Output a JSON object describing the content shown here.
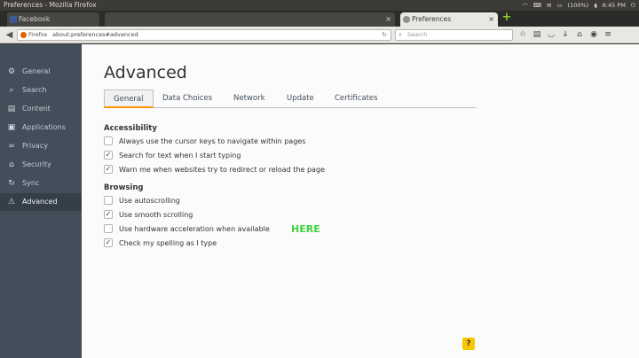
{
  "window": {
    "title": "Preferences - Mozilla Firefox"
  },
  "tray": {
    "battery": "(100%)",
    "time": "6:45 PM"
  },
  "tabs": [
    {
      "label": "Facebook",
      "close": "×"
    },
    {
      "label": "Preferences",
      "close": "×"
    }
  ],
  "newtab_symbol": "+",
  "navbar": {
    "identity": "Firefox",
    "url": "about:preferences#advanced",
    "search_placeholder": "Search"
  },
  "sidebar": {
    "items": [
      {
        "label": "General",
        "icon": "gear-icon"
      },
      {
        "label": "Search",
        "icon": "search-icon"
      },
      {
        "label": "Content",
        "icon": "content-icon"
      },
      {
        "label": "Applications",
        "icon": "applications-icon"
      },
      {
        "label": "Privacy",
        "icon": "privacy-mask-icon"
      },
      {
        "label": "Security",
        "icon": "lock-icon"
      },
      {
        "label": "Sync",
        "icon": "sync-icon"
      },
      {
        "label": "Advanced",
        "icon": "warning-icon"
      }
    ]
  },
  "page": {
    "title": "Advanced",
    "tabs": [
      "General",
      "Data Choices",
      "Network",
      "Update",
      "Certificates"
    ],
    "accessibility": {
      "heading": "Accessibility",
      "options": [
        {
          "label": "Always use the cursor keys to navigate within pages",
          "checked": false
        },
        {
          "label": "Search for text when I start typing",
          "checked": true
        },
        {
          "label": "Warn me when websites try to redirect or reload the page",
          "checked": true
        }
      ]
    },
    "browsing": {
      "heading": "Browsing",
      "options": [
        {
          "label": "Use autoscrolling",
          "checked": false
        },
        {
          "label": "Use smooth scrolling",
          "checked": true
        },
        {
          "label": "Use hardware acceleration when available",
          "checked": false
        },
        {
          "label": "Check my spelling as I type",
          "checked": true
        }
      ]
    },
    "annotation": "HERE",
    "help": "?"
  },
  "colors": {
    "accent": "#ff9500",
    "sidebar": "#424f5a",
    "annotation": "#3fd33f"
  }
}
